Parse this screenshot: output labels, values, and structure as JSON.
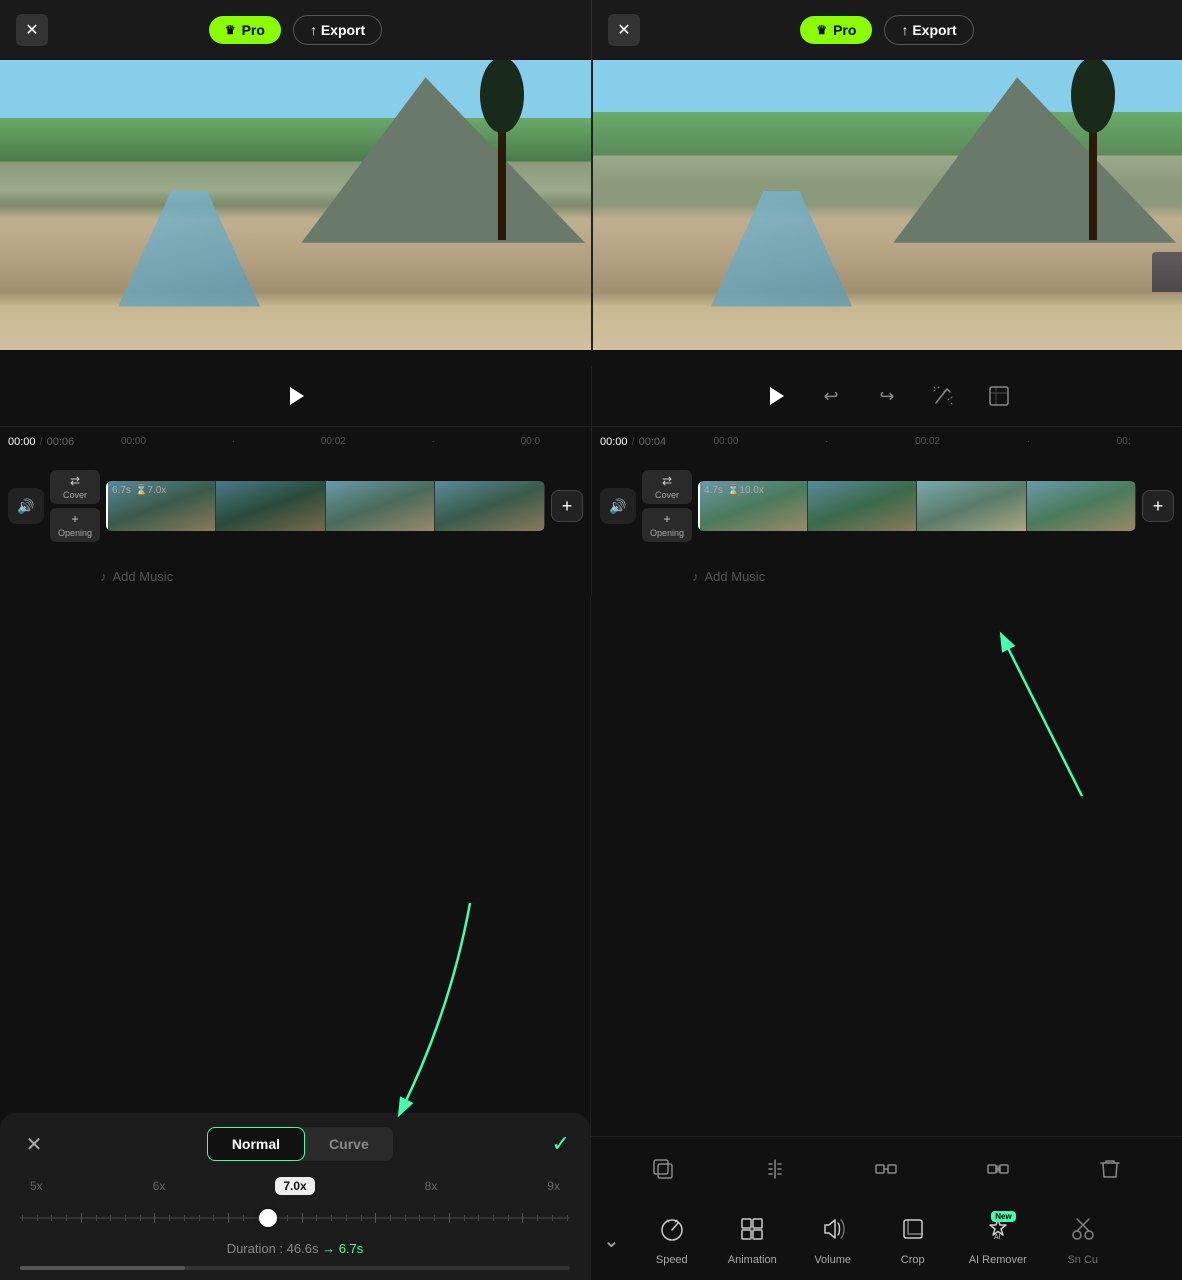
{
  "header": {
    "left": {
      "close_label": "✕",
      "pro_label": "Pro",
      "export_label": "↑ Export",
      "crown": "♛"
    },
    "right": {
      "close_label": "✕",
      "pro_label": "Pro",
      "export_label": "↑ Export",
      "crown": "♛"
    }
  },
  "timeline": {
    "left": {
      "current_time": "00:00",
      "total_time": "00:06",
      "ticks": [
        "00:00",
        "·",
        "00:02",
        "·",
        "00:0"
      ],
      "track_duration": "6.7s",
      "track_speed": "⌛7.0x",
      "cover_label": "Cover",
      "opening_label": "Opening"
    },
    "right": {
      "current_time": "00:00",
      "total_time": "00:04",
      "ticks": [
        "00:00",
        "·",
        "00:02",
        "·",
        "00:"
      ],
      "track_duration": "4.7s",
      "track_speed": "⌛10.0x",
      "cover_label": "Cover",
      "opening_label": "Opening"
    }
  },
  "speed_panel": {
    "close_label": "✕",
    "tab_normal": "Normal",
    "tab_curve": "Curve",
    "confirm_label": "✓",
    "ticks": [
      "5x",
      "6x",
      "7.0x",
      "8x",
      "9x"
    ],
    "current_speed": "7.0x",
    "duration_label": "Duration : 46.6s",
    "arrow_label": "→",
    "duration_after": "6.7s"
  },
  "edit_tools": {
    "icons": [
      "⧉",
      "⸬",
      "⊞",
      "⊟",
      "🗑"
    ]
  },
  "bottom_toolbar": {
    "chevron": "⌄",
    "items": [
      {
        "label": "Speed",
        "icon": "◷"
      },
      {
        "label": "Animation",
        "icon": "▣"
      },
      {
        "label": "Volume",
        "icon": "🔊"
      },
      {
        "label": "Crop",
        "icon": "⊡"
      },
      {
        "label": "AI Remover",
        "icon": "✦",
        "badge": "New"
      },
      {
        "label": "Sn Cu",
        "icon": "✂"
      }
    ]
  },
  "add_music": {
    "icon": "♪",
    "label": "Add Music"
  }
}
